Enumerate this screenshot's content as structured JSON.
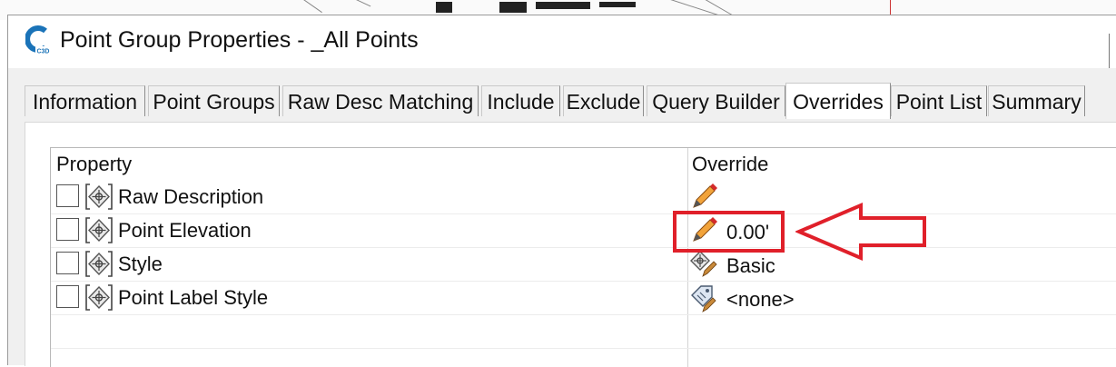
{
  "window": {
    "title": "Point Group Properties - _All Points",
    "app_icon": "civil3d-c3d-logo-icon",
    "app_icon_text": "C3D"
  },
  "tabs": [
    {
      "label": "Information",
      "active": false
    },
    {
      "label": "Point Groups",
      "active": false
    },
    {
      "label": "Raw Desc Matching",
      "active": false
    },
    {
      "label": "Include",
      "active": false
    },
    {
      "label": "Exclude",
      "active": false
    },
    {
      "label": "Query Builder",
      "active": false
    },
    {
      "label": "Overrides",
      "active": true
    },
    {
      "label": "Point List",
      "active": false
    },
    {
      "label": "Summary",
      "active": false
    }
  ],
  "grid": {
    "headers": {
      "property": "Property",
      "override": "Override"
    },
    "rows": [
      {
        "label": "Raw Description",
        "checked": false,
        "override_icon": "pencil-icon",
        "override_value": ""
      },
      {
        "label": "Point Elevation",
        "checked": false,
        "override_icon": "pencil-icon",
        "override_value": "0.00'"
      },
      {
        "label": "Style",
        "checked": false,
        "override_icon": "point-style-icon",
        "override_value": "Basic"
      },
      {
        "label": "Point Label Style",
        "checked": false,
        "override_icon": "label-style-icon",
        "override_value": "<none>"
      }
    ]
  },
  "annotation": {
    "highlight_color": "#e0202a",
    "arrow_direction": "left"
  },
  "colors": {
    "logo_blue": "#1a73b8",
    "pencil_red": "#d42a2a",
    "pencil_orange": "#f2a33a"
  }
}
